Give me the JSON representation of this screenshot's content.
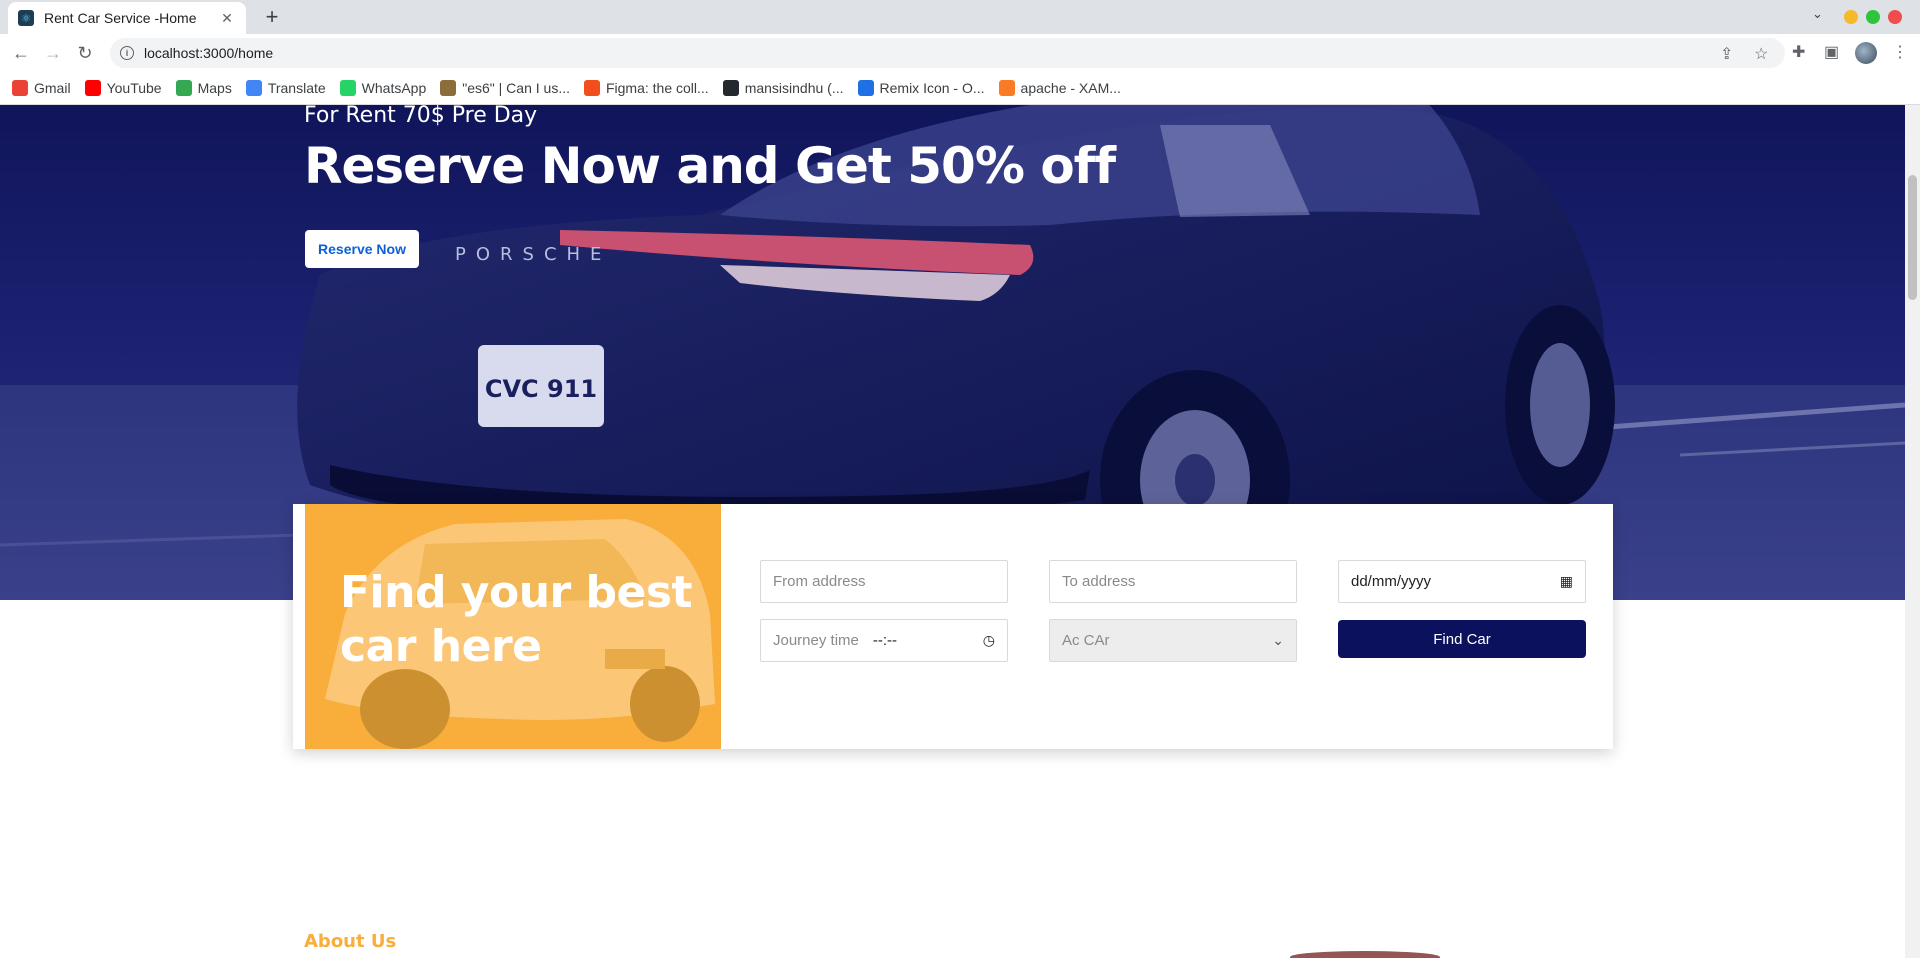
{
  "browser": {
    "tab_title": "Rent Car Service -Home",
    "url": "localhost:3000/home",
    "bookmarks": [
      {
        "label": "Gmail",
        "icon": "gmail-icon",
        "color": "#ea4335"
      },
      {
        "label": "YouTube",
        "icon": "youtube-icon",
        "color": "#ff0000"
      },
      {
        "label": "Maps",
        "icon": "maps-icon",
        "color": "#34a853"
      },
      {
        "label": "Translate",
        "icon": "translate-icon",
        "color": "#4285f4"
      },
      {
        "label": "WhatsApp",
        "icon": "whatsapp-icon",
        "color": "#25d366"
      },
      {
        "label": "\"es6\" | Can I us...",
        "icon": "caniuse-icon",
        "color": "#8b6d3a"
      },
      {
        "label": "Figma: the coll...",
        "icon": "figma-icon",
        "color": "#f24e1e"
      },
      {
        "label": "mansisindhu (...",
        "icon": "github-icon",
        "color": "#24292e"
      },
      {
        "label": "Remix Icon - O...",
        "icon": "remix-icon",
        "color": "#1f6fe5"
      },
      {
        "label": "apache - XAM...",
        "icon": "xampp-icon",
        "color": "#fb7a24"
      }
    ]
  },
  "hero": {
    "subtitle": "For Rent 70$ Pre Day",
    "title": "Reserve Now and Get 50% off",
    "button": "Reserve Now",
    "plate_text": "CVC 911",
    "badge_text": "PORSCHE"
  },
  "find": {
    "title": "Find your best car here",
    "from_placeholder": "From address",
    "to_placeholder": "To address",
    "date_value": "dd/mm/yyyy",
    "time_label": "Journey time",
    "time_value": "--:--",
    "ac_option": "Ac CAr",
    "button": "Find Car"
  },
  "about": {
    "label": "About Us"
  },
  "colors": {
    "accent": "#f9ae3b",
    "primary": "#0b115c",
    "link": "#0d5fd8"
  }
}
